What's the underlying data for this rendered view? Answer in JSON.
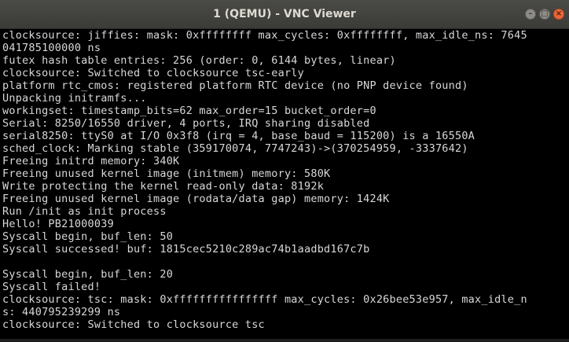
{
  "window": {
    "title": "1 (QEMU) - VNC Viewer",
    "controls": {
      "minimize": "–",
      "maximize": "□",
      "close": "×"
    }
  },
  "console": {
    "lines": [
      "clocksource: jiffies: mask: 0xffffffff max_cycles: 0xffffffff, max_idle_ns: 7645",
      "041785100000 ns",
      "futex hash table entries: 256 (order: 0, 6144 bytes, linear)",
      "clocksource: Switched to clocksource tsc-early",
      "platform rtc_cmos: registered platform RTC device (no PNP device found)",
      "Unpacking initramfs...",
      "workingset: timestamp_bits=62 max_order=15 bucket_order=0",
      "Serial: 8250/16550 driver, 4 ports, IRQ sharing disabled",
      "serial8250: ttyS0 at I/O 0x3f8 (irq = 4, base_baud = 115200) is a 16550A",
      "sched_clock: Marking stable (359170074, 7747243)->(370254959, -3337642)",
      "Freeing initrd memory: 340K",
      "Freeing unused kernel image (initmem) memory: 580K",
      "Write protecting the kernel read-only data: 8192k",
      "Freeing unused kernel image (rodata/data gap) memory: 1424K",
      "Run /init as init process",
      "Hello! PB21000039",
      "Syscall begin, buf_len: 50",
      "Syscall successed! buf: 1815cec5210c289ac74b1aadbd167c7b",
      "",
      "Syscall begin, buf_len: 20",
      "Syscall failed!",
      "clocksource: tsc: mask: 0xffffffffffffffff max_cycles: 0x26bee53e957, max_idle_n",
      "s: 440795239299 ns",
      "clocksource: Switched to clocksource tsc",
      "_"
    ]
  }
}
